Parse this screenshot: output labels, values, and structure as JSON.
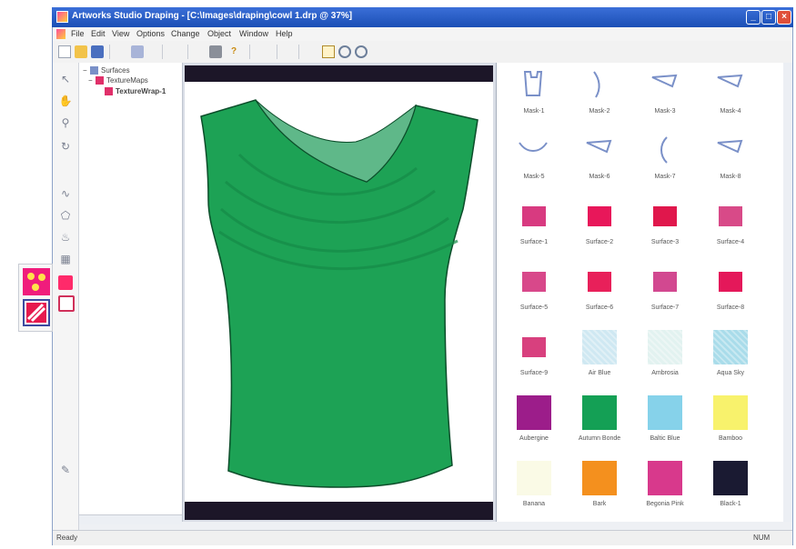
{
  "window": {
    "title": "Artworks Studio Draping - [C:\\Images\\draping\\cowl 1.drp @ 37%]",
    "minimize": "_",
    "maximize": "□",
    "close": "×"
  },
  "menu": [
    "File",
    "Edit",
    "View",
    "Options",
    "Change",
    "Object",
    "Window",
    "Help"
  ],
  "tree": {
    "root": "Surfaces",
    "child": "TextureMaps",
    "leaf": "TextureWrap-1"
  },
  "library": {
    "rows": [
      [
        {
          "label": "Mask-1",
          "kind": "mask",
          "icon": "shape-panel",
          "color": "#7a90c8"
        },
        {
          "label": "Mask-2",
          "kind": "mask",
          "icon": "curve",
          "color": "#7a90c8"
        },
        {
          "label": "Mask-3",
          "kind": "mask",
          "icon": "triangle",
          "color": "#7a90c8"
        },
        {
          "label": "Mask-4",
          "kind": "mask",
          "icon": "triangle",
          "color": "#7a90c8"
        }
      ],
      [
        {
          "label": "Mask-5",
          "kind": "mask",
          "icon": "arc",
          "color": "#7a90c8"
        },
        {
          "label": "Mask-6",
          "kind": "mask",
          "icon": "triangle",
          "color": "#7a90c8"
        },
        {
          "label": "Mask-7",
          "kind": "mask",
          "icon": "bracket",
          "color": "#7a90c8"
        },
        {
          "label": "Mask-8",
          "kind": "mask",
          "icon": "triangle",
          "color": "#7a90c8"
        }
      ],
      [
        {
          "label": "Surface-1",
          "kind": "surface",
          "color": "#d83a80"
        },
        {
          "label": "Surface-2",
          "kind": "surface",
          "color": "#e8175a"
        },
        {
          "label": "Surface-3",
          "kind": "surface",
          "color": "#e0174c"
        },
        {
          "label": "Surface-4",
          "kind": "surface",
          "color": "#d84a88"
        }
      ],
      [
        {
          "label": "Surface-5",
          "kind": "surface",
          "color": "#d8488a"
        },
        {
          "label": "Surface-6",
          "kind": "surface",
          "color": "#e8205a"
        },
        {
          "label": "Surface-7",
          "kind": "surface",
          "color": "#d24890"
        },
        {
          "label": "Surface-8",
          "kind": "surface",
          "color": "#e4185a"
        }
      ],
      [
        {
          "label": "Surface-9",
          "kind": "surface",
          "color": "#d8407e"
        },
        {
          "label": "Air Blue",
          "kind": "texture",
          "color": "#cfe8f2"
        },
        {
          "label": "Ambrosia",
          "kind": "texture",
          "color": "#e2f2f0"
        },
        {
          "label": "Aqua Sky",
          "kind": "texture",
          "color": "#a9dcea"
        }
      ],
      [
        {
          "label": "Aubergine",
          "kind": "swatch",
          "color": "#9c1d8a"
        },
        {
          "label": "Autumn Bonde",
          "kind": "swatch",
          "color": "#14a055"
        },
        {
          "label": "Baltic Blue",
          "kind": "swatch",
          "color": "#86d2ea"
        },
        {
          "label": "Bamboo",
          "kind": "swatch",
          "color": "#f8f26c"
        }
      ],
      [
        {
          "label": "Banana",
          "kind": "swatch",
          "color": "#fafae6"
        },
        {
          "label": "Bark",
          "kind": "swatch",
          "color": "#f4901e"
        },
        {
          "label": "Begonia Pink",
          "kind": "swatch",
          "color": "#d8398c"
        },
        {
          "label": "Black-1",
          "kind": "swatch",
          "color": "#1a1a32"
        }
      ]
    ]
  },
  "garment": {
    "fill": "#1da255",
    "cowl_fill": "#5fb889",
    "outline": "#0c4d2a"
  },
  "status": {
    "left": "Ready",
    "right": "NUM"
  }
}
